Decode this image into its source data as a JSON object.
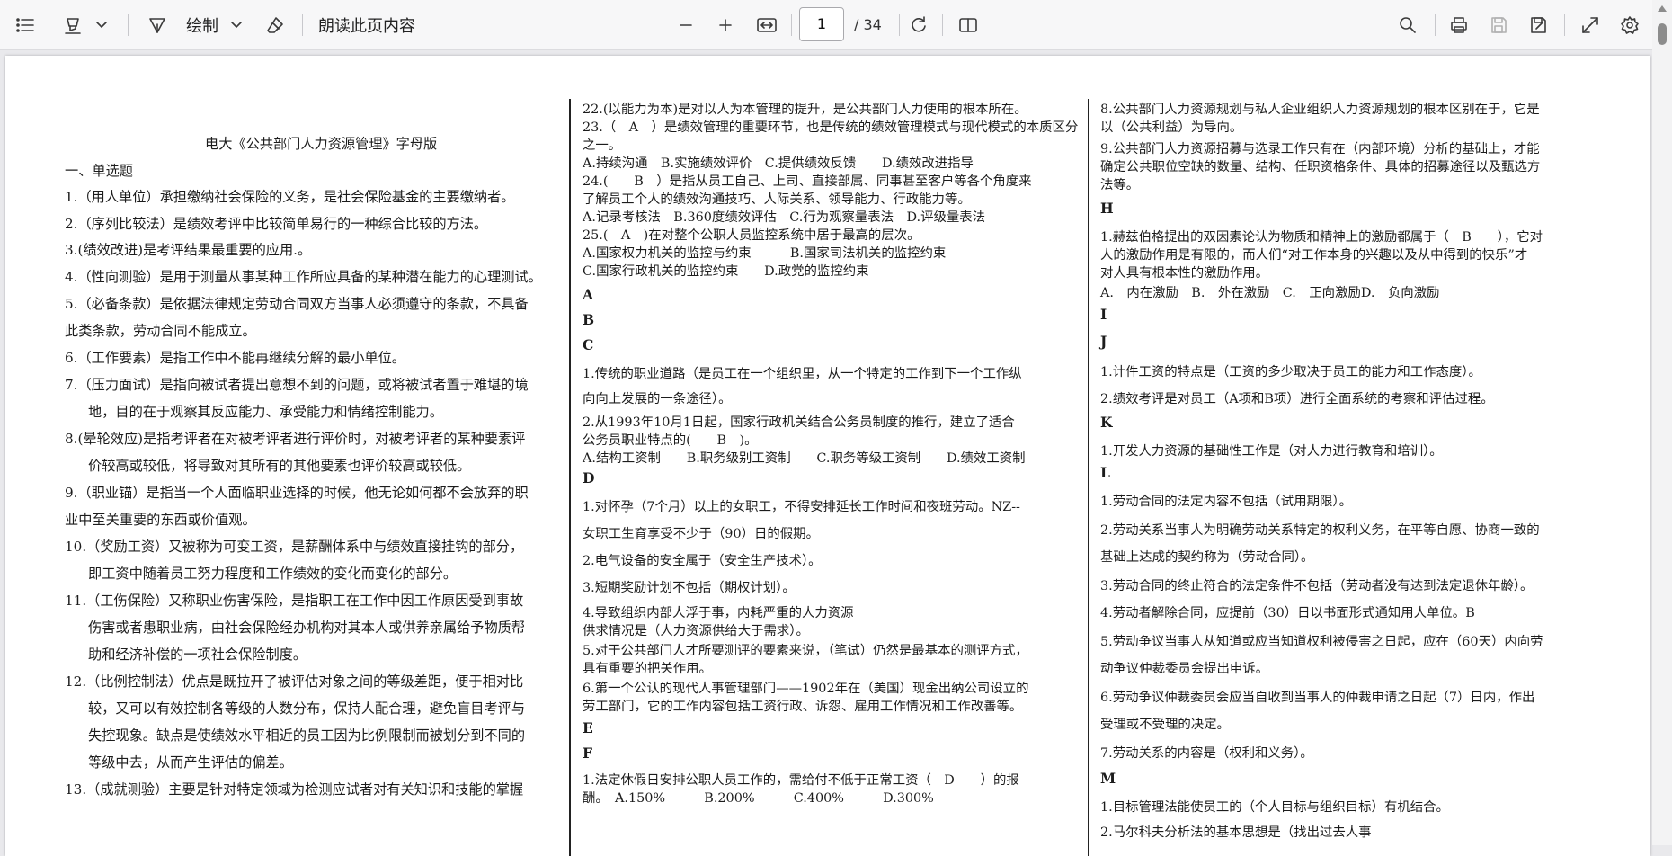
{
  "toolbar": {
    "draw_label": "绘制",
    "read_aloud_label": "朗读此页内容",
    "page_current": "1",
    "page_total": "/ 34"
  },
  "document": {
    "title": "电大《公共部门人力资源管理》字母版",
    "col1": [
      "一、单选题",
      "1.（用人单位）承担缴纳社会保险的义务，是社会保险基金的主要缴纳者。",
      "2.（序列比较法）是绩效考评中比较简单易行的一种综合比较的方法。",
      "3.(绩效改进)是考评结果最重要的应用.。",
      "4.（性向测验）是用于测量从事某种工作所应具备的某种潜在能力的心理测试。",
      "5.（必备条款）是依据法律规定劳动合同双方当事人必须遵守的条款，不具备",
      "此类条款，劳动合同不能成立。",
      "6.（工作要素）是指工作中不能再继续分解的最小单位。",
      "7.（压力面试）是指向被试者提出意想不到的问题，或将被试者置于难堪的境",
      "地，目的在于观察其反应能力、承受能力和情绪控制能力。",
      "8.(晕轮效应)是指考评者在对被考评者进行评价时，对被考评者的某种要素评",
      "价较高或较低，将导致对其所有的其他要素也评价较高或较低。",
      "9.（职业锚）是指当一个人面临职业选择的时候，他无论如何都不会放弃的职",
      "业中至关重要的东西或价值观。",
      "10.（奖励工资）又被称为可变工资，是薪酬体系中与绩效直接挂钩的部分，",
      "即工资中随着员工努力程度和工作绩效的变化而变化的部分。",
      "11.（工伤保险）又称职业伤害保险，是指职工在工作中因工作原因受到事故",
      "伤害或者患职业病，由社会保险经办机构对其本人或供养亲属给予物质帮",
      "助和经济补偿的一项社会保险制度。",
      "12.（比例控制法）优点是既拉开了被评估对象之间的等级差距，便于相对比",
      "较，又可以有效控制各等级的人数分布，保持人配合理，避免盲目考评与",
      "失控现象。缺点是使绩效水平相近的员工因为比例限制而被划分到不同的",
      "等级中去，从而产生评估的偏差。",
      "13.（成就测验）主要是针对特定领域为检测应试者对有关知识和技能的掌握"
    ],
    "col2": [
      "22.(以能力为本)是对以人为本管理的提升，是公共部门人力使用的根本所在。",
      "23.（　A　）是绩效管理的重要环节，也是传统的绩效管理模式与现代模式的本质区分",
      "之一。",
      "A.持续沟通　B.实施绩效评价　C.提供绩效反馈　　D.绩效改进指导",
      "24.(　　B　）是指从员工自己、上司、直接部属、同事甚至客户等各个角度来",
      "了解员工个人的绩效沟通技巧、人际关系、领导能力、行政能力等。",
      "A.记录考核法　B.360度绩效评估　C.行为观察量表法　D.评级量表法",
      "25.(　A　)在对整个公职人员监控系统中居于最高的层次。",
      "A.国家权力机关的监控与约束　　　B.国家司法机关的监控约束",
      "C.国家行政机关的监控约束　　D.政党的监控约束",
      "A",
      "B",
      "C",
      "1.传统的职业道路（是员工在一个组织里，从一个特定的工作到下一个工作纵",
      "向向上发展的一条途径）。",
      "2.从1993年10月1日起，国家行政机关结合公务员制度的推行，建立了适合",
      "公务员职业特点的(　　B　)。",
      "A.结构工资制　　B.职务级别工资制　　C.职务等级工资制　　D.绩效工资制",
      "D",
      "1.对怀孕（7个月）以上的女职工，不得安排延长工作时间和夜班劳动。NZ--",
      "女职工生育享受不少于（90）日的假期。",
      "2.电气设备的安全属于（安全生产技术）。",
      "3.短期奖励计划不包括（期权计划）。",
      "4.导致组织内部人浮于事，内耗严重的人力资源",
      "供求情况是（人力资源供给大于需求）。",
      "5.对于公共部门人才所要测评的要素来说，（笔试）仍然是最基本的测评方式，",
      "具有重要的把关作用。",
      "6.第一个公认的现代人事管理部门——1902年在（美国）现金出纳公司设立的",
      "劳工部门，它的工作内容包括工资行政、诉怨、雇用工作情况和工作改善等。",
      "E",
      "F",
      "1.法定休假日安排公职人员工作的，需给付不低于正常工资（　D　　）的报",
      "酬。　A.150%　　　B.200%　　　C.400%　　　D.300%"
    ],
    "col3": [
      "8.公共部门人力资源规划与私人企业组织人力资源规划的根本区别在于，它是",
      "以（公共利益）为导向。",
      "9.公共部门人力资源招募与选录工作只有在（内部环境）分析的基础上，才能",
      "确定公共职位空缺的数量、结构、任职资格条件、具体的招募途径以及甄选方",
      "法等。",
      "H",
      "1.赫兹伯格提出的双因素论认为物质和精神上的激励都属于（　B　　），它对",
      "人的激励作用是有限的，而人们“对工作本身的兴趣以及从中得到的快乐”才",
      "对人具有根本性的激励作用。",
      "A.　内在激励　B.　外在激励　C.　正向激励D.　负向激励",
      "I",
      "J",
      "1.计件工资的特点是（工资的多少取决于员工的能力和工作态度）。",
      "2.绩效考评是对员工（A项和B项）进行全面系统的考察和评估过程。",
      "K",
      "1.开发人力资源的基础性工作是（对人力进行教育和培训）。",
      "L",
      "1.劳动合同的法定内容不包括（试用期限）。",
      "2.劳动关系当事人为明确劳动关系特定的权利义务，在平等自愿、协商一致的",
      "基础上达成的契约称为（劳动合同）。",
      "3.劳动合同的终止符合的法定条件不包括（劳动者没有达到法定退休年龄）。",
      "4.劳动者解除合同，应提前（30）日以书面形式通知用人单位。B",
      "5.劳动争议当事人从知道或应当知道权利被侵害之日起，应在（60天）内向劳",
      "动争议仲裁委员会提出申诉。",
      "6.劳动争议仲裁委员会应当自收到当事人的仲裁申请之日起（7）日内，作出",
      "受理或不受理的决定。",
      "7.劳动关系的内容是（权利和义务）。",
      "M",
      "1.目标管理法能使员工的（个人目标与组织目标）有机结合。",
      "2.马尔科夫分析法的基本思想是（找出过去人事"
    ]
  }
}
